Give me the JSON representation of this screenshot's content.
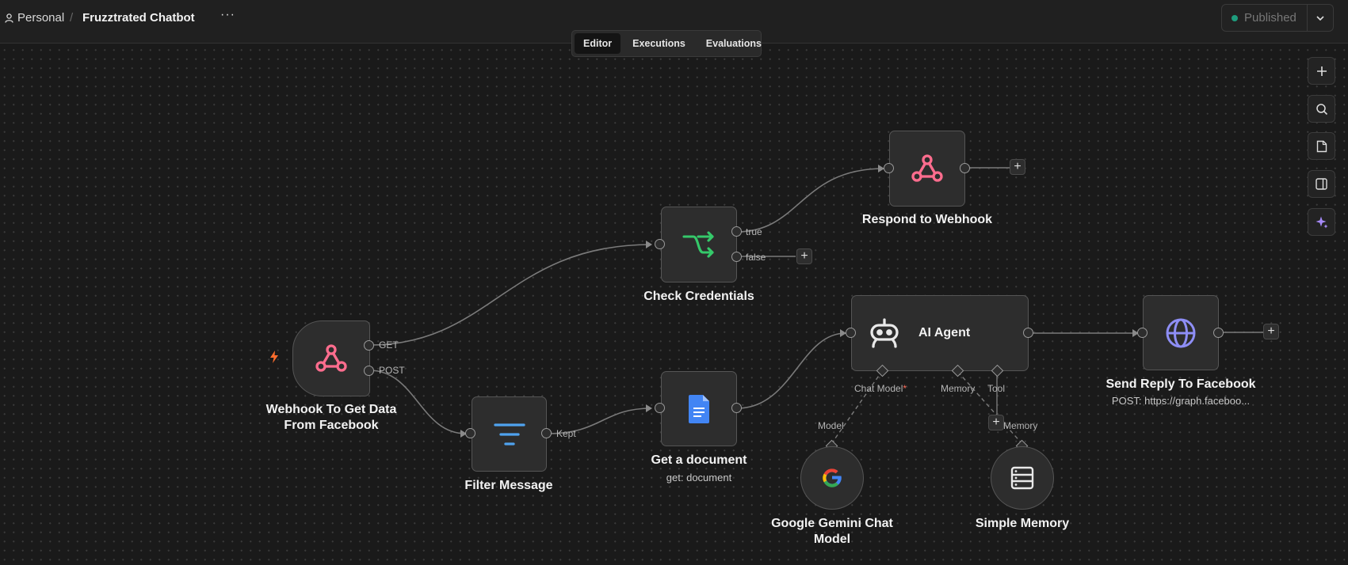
{
  "breadcrumb": {
    "workspace": "Personal",
    "separator": "/",
    "workflow_name": "Fruzztrated Chatbot",
    "more": "···"
  },
  "publish": {
    "label": "Published",
    "status_color": "#1e9c7d"
  },
  "tabs": [
    {
      "label": "Editor",
      "active": true
    },
    {
      "label": "Executions",
      "active": false
    },
    {
      "label": "Evaluations",
      "active": false
    }
  ],
  "right_toolbar": [
    "plus-icon",
    "zoom-icon",
    "sticky-note-icon",
    "panel-toggle-icon",
    "ai-sparkle-icon"
  ],
  "nodes": {
    "webhook": {
      "name": "Webhook To Get Data From Facebook",
      "name_line1": "Webhook To Get Data",
      "name_line2": "From Facebook",
      "out_get": "GET",
      "out_post": "POST",
      "icon": "webhook-icon",
      "trigger_icon": "lightning-icon"
    },
    "check": {
      "name": "Check Credentials",
      "out_true": "true",
      "out_false": "false",
      "icon": "if-icon"
    },
    "respond": {
      "name": "Respond to Webhook",
      "icon": "webhook-icon"
    },
    "filter": {
      "name": "Filter Message",
      "out_kept": "Kept",
      "icon": "filter-icon"
    },
    "getdoc": {
      "name": "Get a document",
      "subtitle": "get: document",
      "icon": "google-docs-icon"
    },
    "agent": {
      "name": "AI Agent",
      "in_chat_model": "Chat Model",
      "required_mark": "*",
      "in_memory": "Memory",
      "in_tool": "Tool",
      "icon": "robot-icon"
    },
    "send": {
      "name": "Send Reply To Facebook",
      "subtitle": "POST: https://graph.faceboo...",
      "icon": "globe-icon"
    },
    "gemini": {
      "name_line1": "Google Gemini Chat",
      "name_line2": "Model",
      "out_label": "Model",
      "icon": "google-icon"
    },
    "memory": {
      "name": "Simple Memory",
      "out_label": "Memory",
      "icon": "database-icon"
    }
  },
  "colors": {
    "webhook": "#ff6d8e",
    "if": "#35c96a",
    "filter": "#4fa3ef",
    "docs": "#4285f4",
    "globe": "#8e8ef5",
    "trigger": "#ff6d2d",
    "accent": "#8b5cf6"
  }
}
